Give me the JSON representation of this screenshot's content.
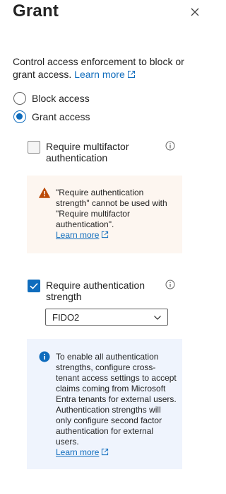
{
  "panel": {
    "title": "Grant",
    "description": "Control access enforcement to block or grant access.",
    "learn_more": "Learn more"
  },
  "radios": {
    "block": "Block access",
    "grant": "Grant access",
    "selected": "grant"
  },
  "mfa": {
    "label": "Require multifactor authentication",
    "checked": false
  },
  "warning": {
    "text": "\"Require authentication strength\" cannot be used with \"Require multifactor authentication\".",
    "learn_more": "Learn more"
  },
  "auth_strength": {
    "label": "Require authentication strength",
    "checked": true,
    "selected": "FIDO2"
  },
  "info_box": {
    "text": "To enable all authentication strengths, configure cross-tenant access settings to accept claims coming from Microsoft Entra tenants for external users. Authentication strengths will only configure second factor authentication for external users.",
    "learn_more": "Learn more"
  },
  "colors": {
    "accent": "#0f6cbd",
    "warning_bg": "#fdf6f0",
    "warning_icon": "#bc4b09",
    "info_bg": "#eff4fd"
  }
}
